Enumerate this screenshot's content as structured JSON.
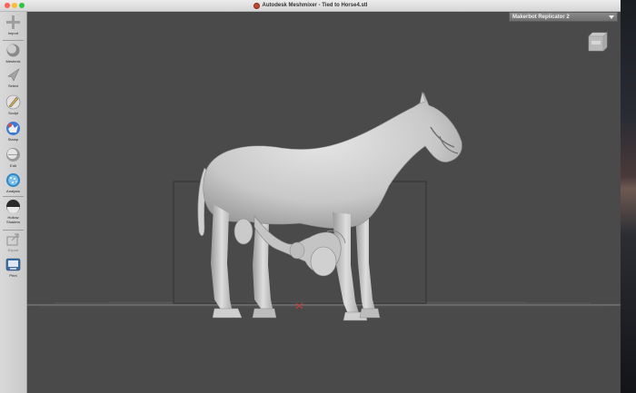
{
  "window": {
    "title": "Autodesk Meshmixer - Tied to Horse4.stl"
  },
  "toolbar": {
    "items": [
      {
        "label": "Import",
        "icon": "plus-icon"
      },
      {
        "label": "Meshmix",
        "icon": "sphere-icon"
      },
      {
        "label": "Select",
        "icon": "arrow-select-icon"
      },
      {
        "label": "Sculpt",
        "icon": "brush-icon"
      },
      {
        "label": "Stamp",
        "icon": "stamp-icon"
      },
      {
        "label": "Edit",
        "icon": "edit-sphere-icon"
      },
      {
        "label": "Analysis",
        "icon": "analysis-icon"
      },
      {
        "label": "Shaders",
        "sublabel": "Hollow",
        "icon": "shader-icon"
      },
      {
        "label": "Export",
        "icon": "export-icon"
      },
      {
        "label": "Print",
        "icon": "print-icon"
      }
    ]
  },
  "printer": {
    "selected": "Makerbot Replicator 2"
  },
  "colors": {
    "viewport_bg": "#4a4a4a",
    "model": "#d2d2d2",
    "toolbar_bg": "#d0d0d0"
  }
}
